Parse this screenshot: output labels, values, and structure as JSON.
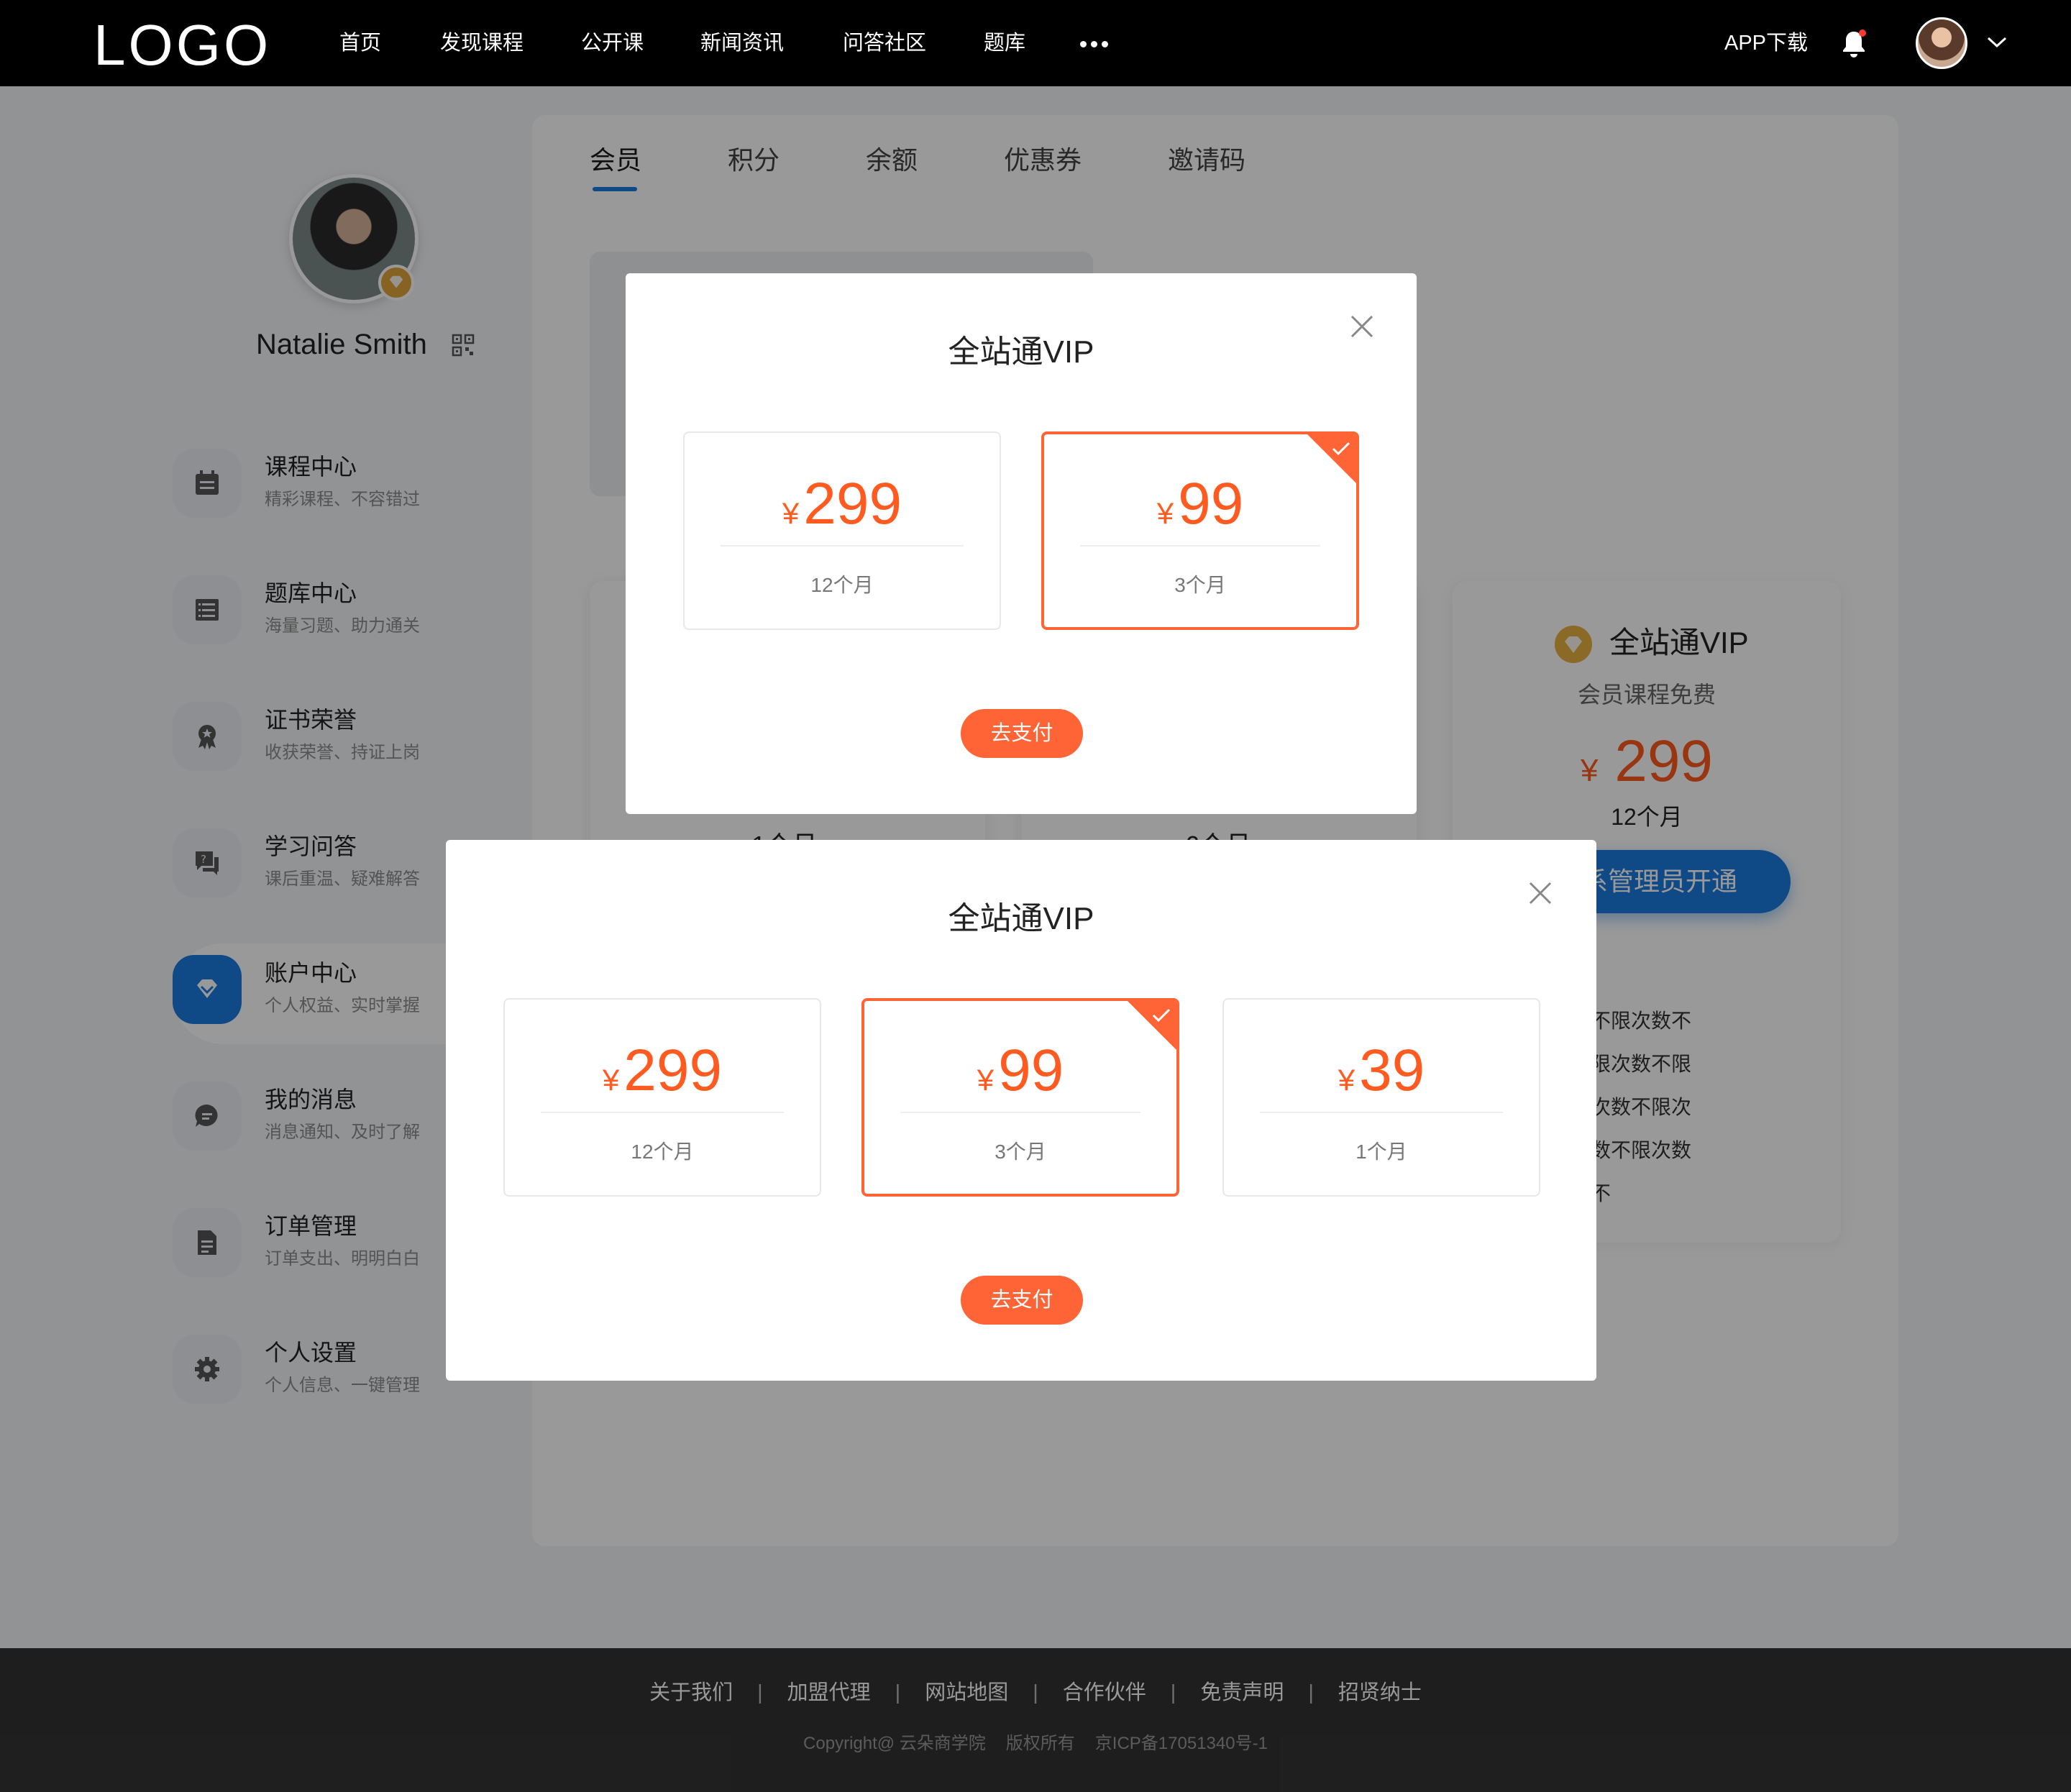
{
  "topnav": {
    "logo": "LOGO",
    "items": [
      "首页",
      "发现课程",
      "公开课",
      "新闻资讯",
      "问答社区",
      "题库"
    ],
    "app_download": "APP下载"
  },
  "profile": {
    "name": "Natalie Smith"
  },
  "sidebar": {
    "items": [
      {
        "title": "课程中心",
        "subtitle": "精彩课程、不容错过",
        "icon": "calendar-icon"
      },
      {
        "title": "题库中心",
        "subtitle": "海量习题、助力通关",
        "icon": "list-icon"
      },
      {
        "title": "证书荣誉",
        "subtitle": "收获荣誉、持证上岗",
        "icon": "award-icon"
      },
      {
        "title": "学习问答",
        "subtitle": "课后重温、疑难解答",
        "icon": "qa-icon"
      },
      {
        "title": "账户中心",
        "subtitle": "个人权益、实时掌握",
        "icon": "diamond-icon"
      },
      {
        "title": "我的消息",
        "subtitle": "消息通知、及时了解",
        "icon": "message-icon"
      },
      {
        "title": "订单管理",
        "subtitle": "订单支出、明明白白",
        "icon": "document-icon"
      },
      {
        "title": "个人设置",
        "subtitle": "个人信息、一键管理",
        "icon": "gear-icon"
      }
    ],
    "active_index": 4
  },
  "tabs": [
    "会员",
    "积分",
    "余额",
    "优惠券",
    "邀请码"
  ],
  "background_cards": {
    "dur_left": "1个月",
    "dur_mid": "6个月"
  },
  "vip_card": {
    "title": "全站通VIP",
    "subtitle": "会员课程免费",
    "currency": "¥",
    "price": "299",
    "duration": "12个月",
    "button": "联系管理员开通",
    "features": [
      "不限次数不限次数不",
      "限次数不限次数不限",
      "次数不限次数不限次",
      "数不限次数不限次数",
      "不限次数不"
    ]
  },
  "modal_top": {
    "title": "全站通VIP",
    "plans": [
      {
        "currency": "¥",
        "price": "299",
        "duration": "12个月",
        "selected": false
      },
      {
        "currency": "¥",
        "price": "99",
        "duration": "3个月",
        "selected": true
      }
    ],
    "pay_button": "去支付"
  },
  "modal_bottom": {
    "title": "全站通VIP",
    "plans": [
      {
        "currency": "¥",
        "price": "299",
        "duration": "12个月",
        "selected": false
      },
      {
        "currency": "¥",
        "price": "99",
        "duration": "3个月",
        "selected": true
      },
      {
        "currency": "¥",
        "price": "39",
        "duration": "1个月",
        "selected": false
      }
    ],
    "pay_button": "去支付"
  },
  "footer": {
    "links": [
      "关于我们",
      "加盟代理",
      "网站地图",
      "合作伙伴",
      "免责声明",
      "招贤纳士"
    ],
    "copyright": "Copyright@ 云朵商学院",
    "rights": "版权所有",
    "icp": "京ICP备17051340号-1"
  },
  "colors": {
    "accent_orange": "#ff6436",
    "price_orange": "#ff5a1f",
    "brand_blue": "#1a7ae0",
    "nav_bg": "#000000",
    "footer_bg": "#333333"
  }
}
